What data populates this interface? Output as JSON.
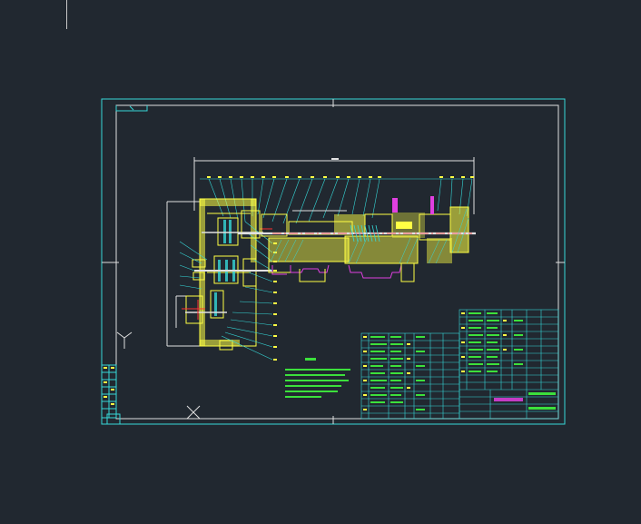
{
  "drawing": {
    "title_block_name": "锥孔镗床主轴箱",
    "technical_requirements_heading": "技术要求",
    "colors": {
      "background": "#212830",
      "frame": "#36d8d8",
      "part_outline": "#ffff44",
      "leader_lines": "#36d8d8",
      "section_hatch": "#ffff44",
      "hidden_parts": "#e040e0",
      "red_center": "#ff3030",
      "text_green": "#3ce03c",
      "white": "#e0e0e0"
    }
  },
  "ucs": {
    "icon": "ucs-axis-icon"
  },
  "crosshair": {
    "icon": "crosshair-icon"
  }
}
